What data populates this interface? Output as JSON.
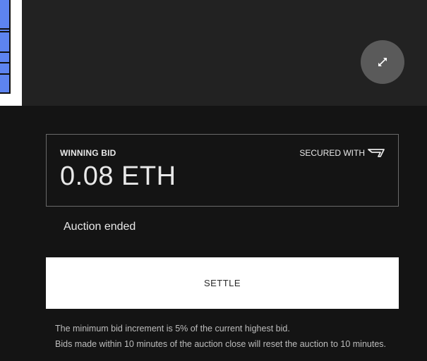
{
  "artwork": {
    "alt": "Noun artwork"
  },
  "media": {
    "expand_icon": "expand-arrows-icon"
  },
  "bid_card": {
    "label": "WINNING BID",
    "amount": "0.08 ETH",
    "secured_label": "SECURED WITH",
    "secured_icon": "protocol-logo-icon"
  },
  "auction": {
    "status": "Auction ended"
  },
  "actions": {
    "settle_label": "SETTLE"
  },
  "info": {
    "min_increment": "The minimum bid increment is 5% of the current highest bid.",
    "reset_notice": "Bids made within 10 minutes of the auction close will reset the auction to 10 minutes."
  },
  "colors": {
    "page_bg": "#141414",
    "media_bg": "#222222",
    "card_border": "#6a6a6a",
    "button_bg": "#ffffff",
    "artwork_blue": "#5d84f0"
  }
}
